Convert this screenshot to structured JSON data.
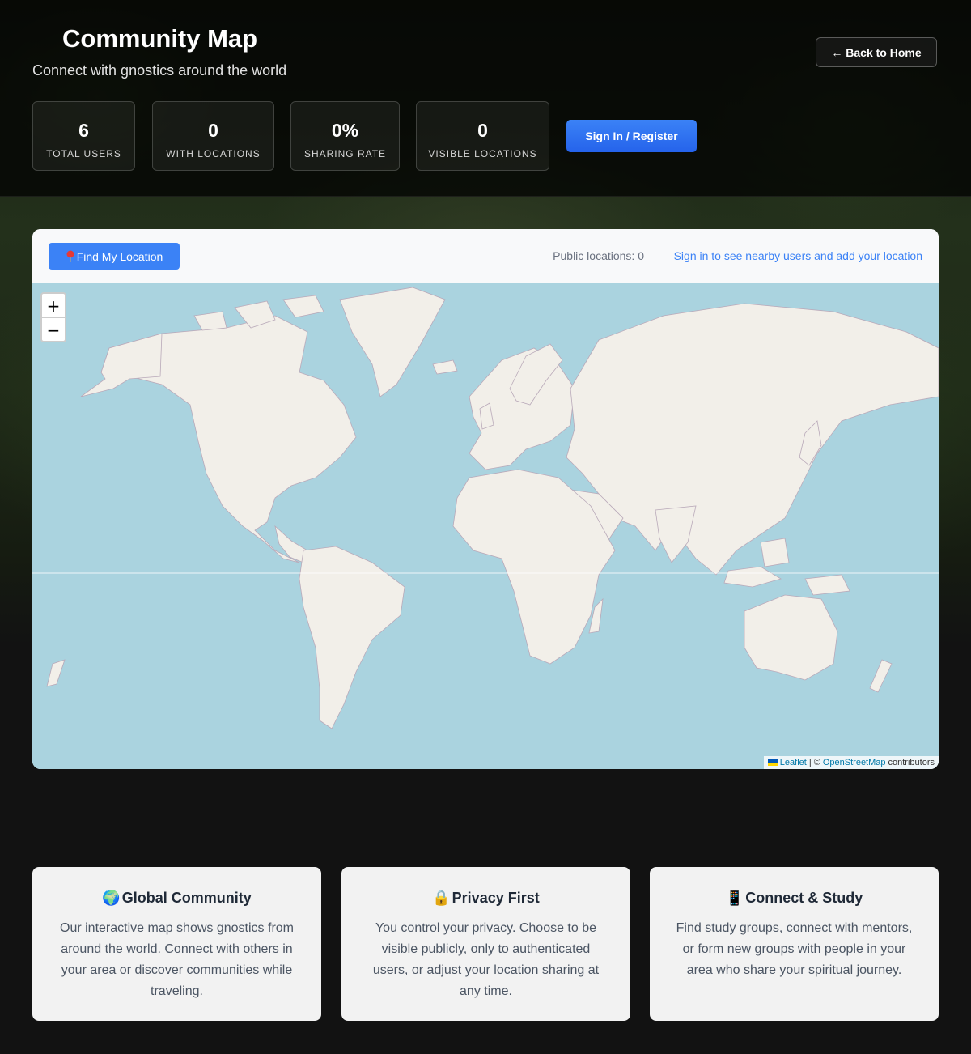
{
  "header": {
    "title": "Community Map",
    "subtitle": "Connect with gnostics around the world",
    "back_label": "← Back to Home"
  },
  "stats": [
    {
      "value": "6",
      "label": "TOTAL USERS"
    },
    {
      "value": "0",
      "label": "WITH LOCATIONS"
    },
    {
      "value": "0%",
      "label": "SHARING RATE"
    },
    {
      "value": "0",
      "label": "VISIBLE LOCATIONS"
    }
  ],
  "signin_label": "Sign In / Register",
  "map": {
    "find_label": "Find My Location",
    "find_icon": "pin-icon",
    "public_locations": "Public locations: 0",
    "signin_prompt": "Sign in to see nearby users and add your location",
    "zoom_in": "+",
    "zoom_out": "−",
    "attribution": {
      "leaflet": "Leaflet",
      "separator": "| ©",
      "osm": "OpenStreetMap",
      "suffix": "contributors"
    },
    "colors": {
      "water": "#aad3df",
      "land": "#f2efe9",
      "border": "#b9a9b9"
    }
  },
  "features": [
    {
      "icon": "🌍",
      "title": "Global Community",
      "text": "Our interactive map shows gnostics from around the world. Connect with others in your area or discover communities while traveling."
    },
    {
      "icon": "🔒",
      "title": "Privacy First",
      "text": "You control your privacy. Choose to be visible publicly, only to authenticated users, or adjust your location sharing at any time."
    },
    {
      "icon": "📱",
      "title": "Connect & Study",
      "text": "Find study groups, connect with mentors, or form new groups with people in your area who share your spiritual journey."
    }
  ],
  "accent": "#3b82f6"
}
